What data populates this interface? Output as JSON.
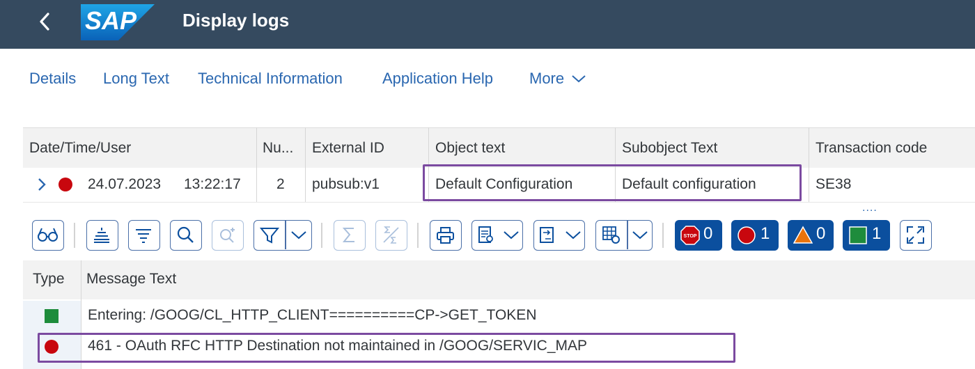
{
  "header": {
    "title": "Display logs",
    "logo_text": "SAP",
    "back_icon": "chevron-left-icon"
  },
  "toolbar": {
    "details": "Details",
    "long_text": "Long Text",
    "technical_information": "Technical Information",
    "application_help": "Application Help",
    "more": "More"
  },
  "log_table": {
    "columns": [
      "Date/Time/User",
      "Nu...",
      "External ID",
      "Object text",
      "Subobject Text",
      "Transaction code"
    ],
    "row": {
      "date": "24.07.2023",
      "time": "13:22:17",
      "number": "2",
      "external_id": "pubsub:v1",
      "object_text": "Default  Configuration",
      "subobject_text": "Default configuration",
      "transaction_code": "SE38",
      "status_color": "#c8070e"
    },
    "more_indicator": "...."
  },
  "message_toolbar": {
    "counts": {
      "stop": "0",
      "error": "1",
      "warning": "0",
      "success": "1"
    },
    "icons": [
      "glasses-icon",
      "sort-ascending-icon",
      "sort-filter-icon",
      "search-icon",
      "search-next-icon",
      "filter-icon",
      "sum-icon",
      "subtotal-icon",
      "print-icon",
      "export-icon",
      "layout-icon",
      "settings-grid-icon",
      "fullscreen-icon"
    ]
  },
  "messages_table": {
    "columns": [
      "Type",
      "Message Text"
    ],
    "rows": [
      {
        "type_icon": "success-square-icon",
        "text": "Entering: /GOOG/CL_HTTP_CLIENT==========CP->GET_TOKEN",
        "color": "#1e8c3c"
      },
      {
        "type_icon": "error-circle-icon",
        "text": "461 - OAuth RFC HTTP Destination not maintained in /GOOG/SERVIC_MAP",
        "color": "#c8070e"
      }
    ]
  },
  "colors": {
    "shell": "#354a5f",
    "link": "#2a67b0",
    "highlight": "#7b4aa0",
    "count_button": "#0b4f9e"
  }
}
